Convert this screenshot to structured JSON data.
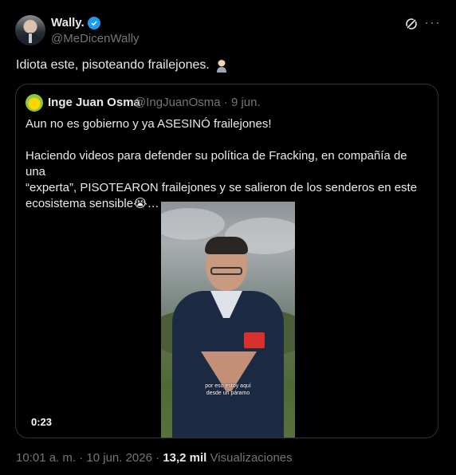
{
  "author": {
    "name": "Wally.",
    "handle": "@MeDicenWally"
  },
  "tweet": {
    "text": "Idiota este, pisoteando frailejones."
  },
  "quoted": {
    "name": "Inge Juan Osma",
    "handle": "@IngJuanOsma",
    "separator": "·",
    "date": "9 jun.",
    "line1": "Aun no es gobierno y ya ASESINÓ frailejones!",
    "line2": "Haciendo videos para defender su política de Fracking, en compañía de una",
    "line3": "“experta”, PISOTEARON frailejones y se salieron de los senderos en este",
    "line4": "ecosistema sensible😭…",
    "video": {
      "caption_line1": "por eso estoy aquí",
      "caption_line2": "desde un páramo",
      "duration": "0:23"
    }
  },
  "footer": {
    "time": "10:01 a. m.",
    "separator1": "·",
    "date": "10 jun. 2026",
    "separator2": "·",
    "views_count": "13,2 mil",
    "views_label": "Visualizaciones"
  },
  "colors": {
    "background": "#000000",
    "text": "#e7e9ea",
    "muted": "#71767b",
    "border": "#2f3336",
    "verified": "#1d9bf0"
  }
}
